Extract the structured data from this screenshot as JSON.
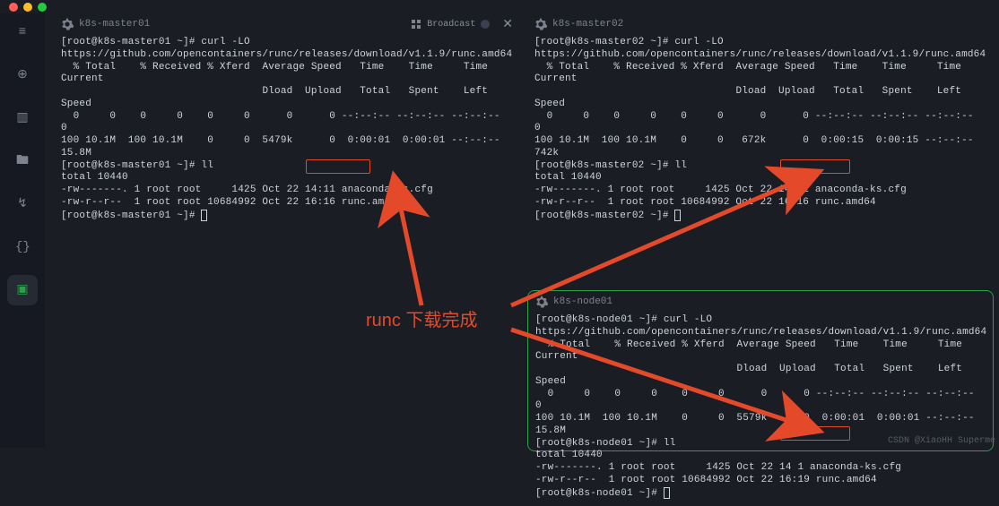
{
  "sidebar": {
    "items": [
      {
        "name": "menu-icon",
        "glyph": "≡"
      },
      {
        "name": "search-plus-icon",
        "glyph": "⊕"
      },
      {
        "name": "server-icon",
        "glyph": "▥"
      },
      {
        "name": "folder-icon",
        "glyph": "🖿"
      },
      {
        "name": "zigzag-icon",
        "glyph": "↯"
      },
      {
        "name": "braces-icon",
        "glyph": "{}"
      },
      {
        "name": "terminal-icon",
        "glyph": "▣"
      }
    ]
  },
  "broadcast": {
    "label": "Broadcast"
  },
  "panes": {
    "p1": {
      "title": "k8s-master01",
      "text": "[root@k8s-master01 ~]# curl -LO https://github.com/opencontainers/runc/releases/download/v1.1.9/runc.amd64\n  % Total    % Received % Xferd  Average Speed   Time    Time     Time  Current\n                                 Dload  Upload   Total   Spent    Left  Speed\n  0     0    0     0    0     0      0      0 --:--:-- --:--:-- --:--:--     0\n100 10.1M  100 10.1M    0     0  5479k      0  0:00:01  0:00:01 --:--:-- 15.8M\n[root@k8s-master01 ~]# ll\ntotal 10440\n-rw-------. 1 root root     1425 Oct 22 14:11 anaconda-ks.cfg\n-rw-r--r--  1 root root 10684992 Oct 22 16:16 runc.amd64\n[root@k8s-master01 ~]# "
    },
    "p2": {
      "title": "k8s-master02",
      "text": "[root@k8s-master02 ~]# curl -LO https://github.com/opencontainers/runc/releases/download/v1.1.9/runc.amd64\n  % Total    % Received % Xferd  Average Speed   Time    Time     Time  Current\n                                 Dload  Upload   Total   Spent    Left  Speed\n  0     0    0     0    0     0      0      0 --:--:-- --:--:-- --:--:--     0\n100 10.1M  100 10.1M    0     0   672k      0  0:00:15  0:00:15 --:--:--  742k\n[root@k8s-master02 ~]# ll\ntotal 10440\n-rw-------. 1 root root     1425 Oct 22 14:11 anaconda-ks.cfg\n-rw-r--r--  1 root root 10684992 Oct 22 16:16 runc.amd64\n[root@k8s-master02 ~]# "
    },
    "p3": {
      "title": "k8s-node01",
      "text": "[root@k8s-node01 ~]# curl -LO https://github.com/opencontainers/runc/releases/download/v1.1.9/runc.amd64\n  % Total    % Received % Xferd  Average Speed   Time    Time     Time  Current\n                                 Dload  Upload   Total   Spent    Left  Speed\n  0     0    0     0    0     0      0      0 --:--:-- --:--:-- --:--:--     0\n100 10.1M  100 10.1M    0     0  5579k      0  0:00:01  0:00:01 --:--:-- 15.8M\n[root@k8s-node01 ~]# ll\ntotal 10440\n-rw-------. 1 root root     1425 Oct 22 14 1 anaconda-ks.cfg\n-rw-r--r--  1 root root 10684992 Oct 22 16:19 runc.amd64\n[root@k8s-node01 ~]# "
    }
  },
  "annotation": {
    "label": "runc 下载完成"
  },
  "watermark": "CSDN @XiaoHH Superme"
}
